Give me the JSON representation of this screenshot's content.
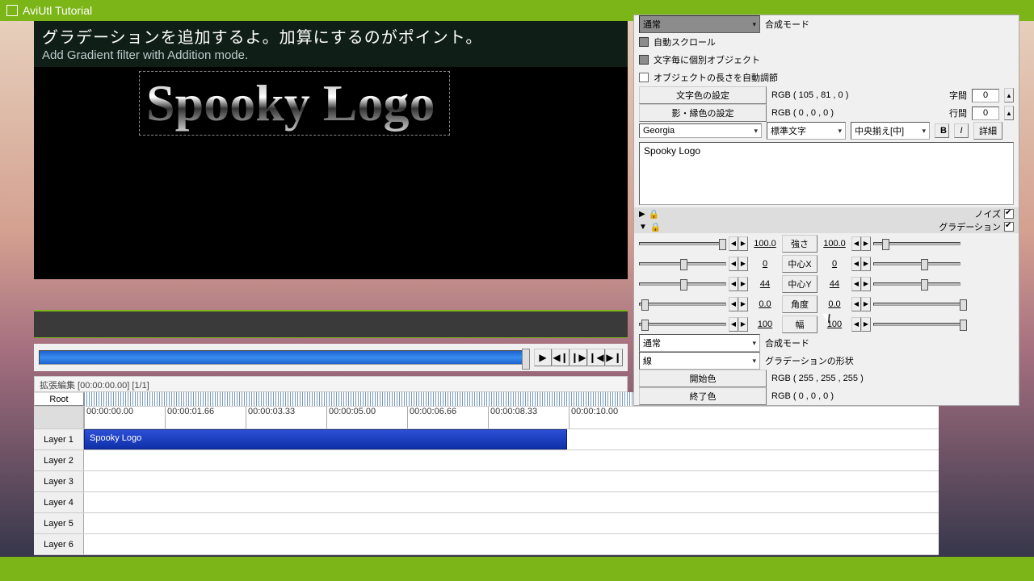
{
  "title": "AviUtl Tutorial",
  "banner": {
    "jp": "グラデーションを追加するよ。加算にするのがポイント。",
    "en": "Add Gradient filter with Addition mode."
  },
  "logo_text": "Spooky Logo",
  "timeline_header": "拡張編集 [00:00:00.00] [1/1]",
  "root_label": "Root",
  "timecodes": [
    "00:00:00.00",
    "00:00:01.66",
    "00:00:03.33",
    "00:00:05.00",
    "00:00:06.66",
    "00:00:08.33",
    "00:00:10.00"
  ],
  "layers": [
    "Layer 1",
    "Layer 2",
    "Layer 3",
    "Layer 4",
    "Layer 5",
    "Layer 6"
  ],
  "clip_label": "Spooky Logo",
  "props": {
    "dim_dropdown": "通常",
    "dim_mode_label": "合成モード",
    "dim_autoscroll": "自動スクロール",
    "dim_perchar": "文字毎に個別オブジェクト",
    "auto_length": "オブジェクトの長さを自動調節",
    "text_color_btn": "文字色の設定",
    "text_color_val": "RGB ( 105 , 81 , 0 )",
    "shadow_color_btn": "影・縁色の設定",
    "shadow_color_val": "RGB ( 0 , 0 , 0 )",
    "spacing_label": "字間",
    "spacing_val": "0",
    "lineh_label": "行間",
    "lineh_val": "0",
    "font": "Georgia",
    "style": "標準文字",
    "align": "中央揃え[中]",
    "bold": "B",
    "italic": "I",
    "detail": "詳細",
    "text_content": "Spooky Logo",
    "noise_label": "ノイズ",
    "gradient_label": "グラデーション",
    "params": [
      {
        "l": "100.0",
        "name": "強さ",
        "r": "100.0"
      },
      {
        "l": "0",
        "name": "中心X",
        "r": "0"
      },
      {
        "l": "44",
        "name": "中心Y",
        "r": "44"
      },
      {
        "l": "0.0",
        "name": "角度",
        "r": "0.0"
      },
      {
        "l": "100",
        "name": "幅",
        "r": "100"
      }
    ],
    "blend_sel": "通常",
    "blend_label": "合成モード",
    "shape_sel": "線",
    "shape_label": "グラデーションの形状",
    "start_color_btn": "開始色",
    "start_color_val": "RGB ( 255 , 255 , 255 )",
    "end_color_btn": "終了色",
    "end_color_val": "RGB ( 0 , 0 , 0 )"
  }
}
